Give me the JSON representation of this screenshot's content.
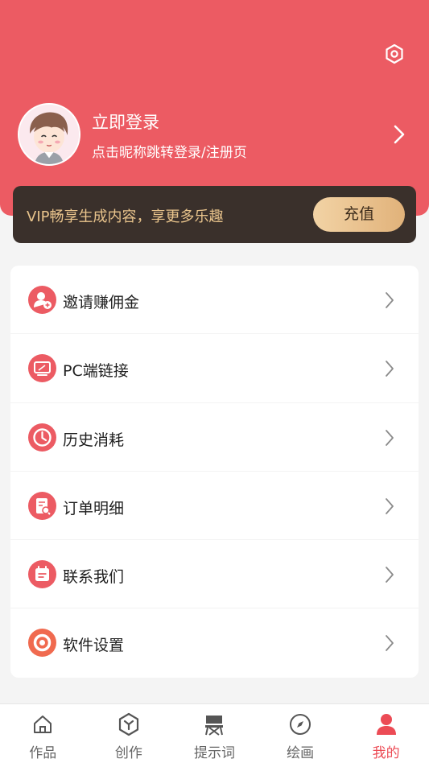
{
  "profile": {
    "login_title": "立即登录",
    "login_subtitle": "点击昵称跳转登录/注册页"
  },
  "vip": {
    "text": "VIP畅享生成内容，享更多乐趣",
    "button": "充值"
  },
  "menu": [
    {
      "label": "邀请赚佣金",
      "icon": "invite-user-icon"
    },
    {
      "label": "PC端链接",
      "icon": "monitor-icon"
    },
    {
      "label": "历史消耗",
      "icon": "history-clock-icon"
    },
    {
      "label": "订单明细",
      "icon": "order-search-icon"
    },
    {
      "label": "联系我们",
      "icon": "calendar-contact-icon"
    },
    {
      "label": "软件设置",
      "icon": "settings-ring-icon"
    }
  ],
  "tabs": [
    {
      "label": "作品",
      "icon": "home-icon",
      "active": false
    },
    {
      "label": "创作",
      "icon": "create-hexagon-icon",
      "active": false
    },
    {
      "label": "提示词",
      "icon": "director-chair-icon",
      "active": false
    },
    {
      "label": "绘画",
      "icon": "compass-icon",
      "active": false
    },
    {
      "label": "我的",
      "icon": "user-icon",
      "active": true
    }
  ],
  "colors": {
    "primary": "#ec5b63",
    "vip_bg": "#3a302b",
    "vip_text": "#e9c48c",
    "active_tab": "#ec4b55"
  }
}
